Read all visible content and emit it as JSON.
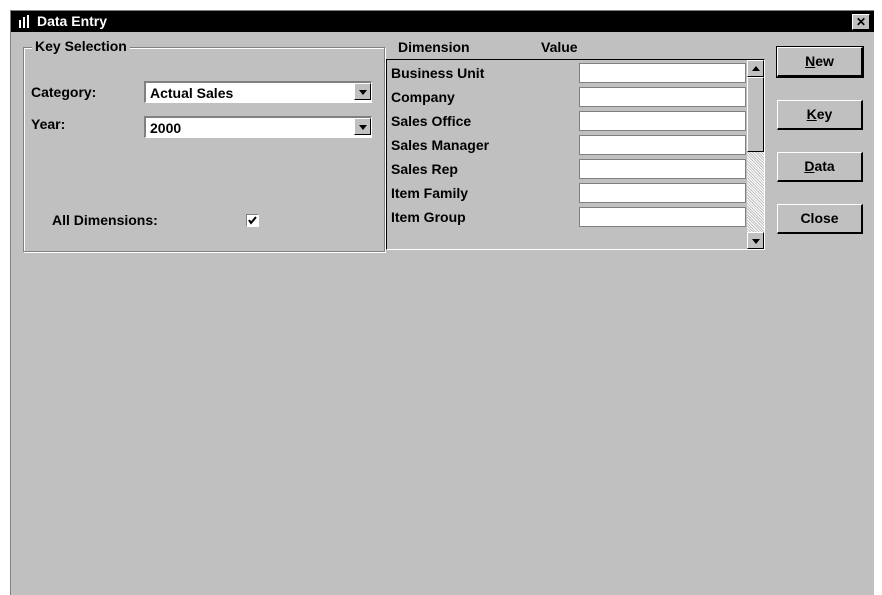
{
  "window": {
    "title": "Data Entry",
    "close_glyph": "✕",
    "icon": "app-icon"
  },
  "key_selection": {
    "legend": "Key Selection",
    "category": {
      "label": "Category:",
      "value": "Actual Sales"
    },
    "year": {
      "label": "Year:",
      "value": "2000"
    },
    "all_dimensions": {
      "label": "All Dimensions:",
      "checked": true
    }
  },
  "grid": {
    "headers": {
      "dimension": "Dimension",
      "value": "Value"
    },
    "rows": [
      {
        "dimension": "Business Unit",
        "value": ""
      },
      {
        "dimension": "Company",
        "value": ""
      },
      {
        "dimension": "Sales Office",
        "value": ""
      },
      {
        "dimension": "Sales Manager",
        "value": ""
      },
      {
        "dimension": "Sales Rep",
        "value": ""
      },
      {
        "dimension": "Item Family",
        "value": ""
      },
      {
        "dimension": "Item Group",
        "value": ""
      }
    ]
  },
  "buttons": {
    "new": {
      "accel": "N",
      "rest": "ew"
    },
    "key": {
      "accel": "K",
      "rest": "ey"
    },
    "data": {
      "accel": "D",
      "rest": "ata"
    },
    "close": {
      "label": "Close"
    }
  }
}
